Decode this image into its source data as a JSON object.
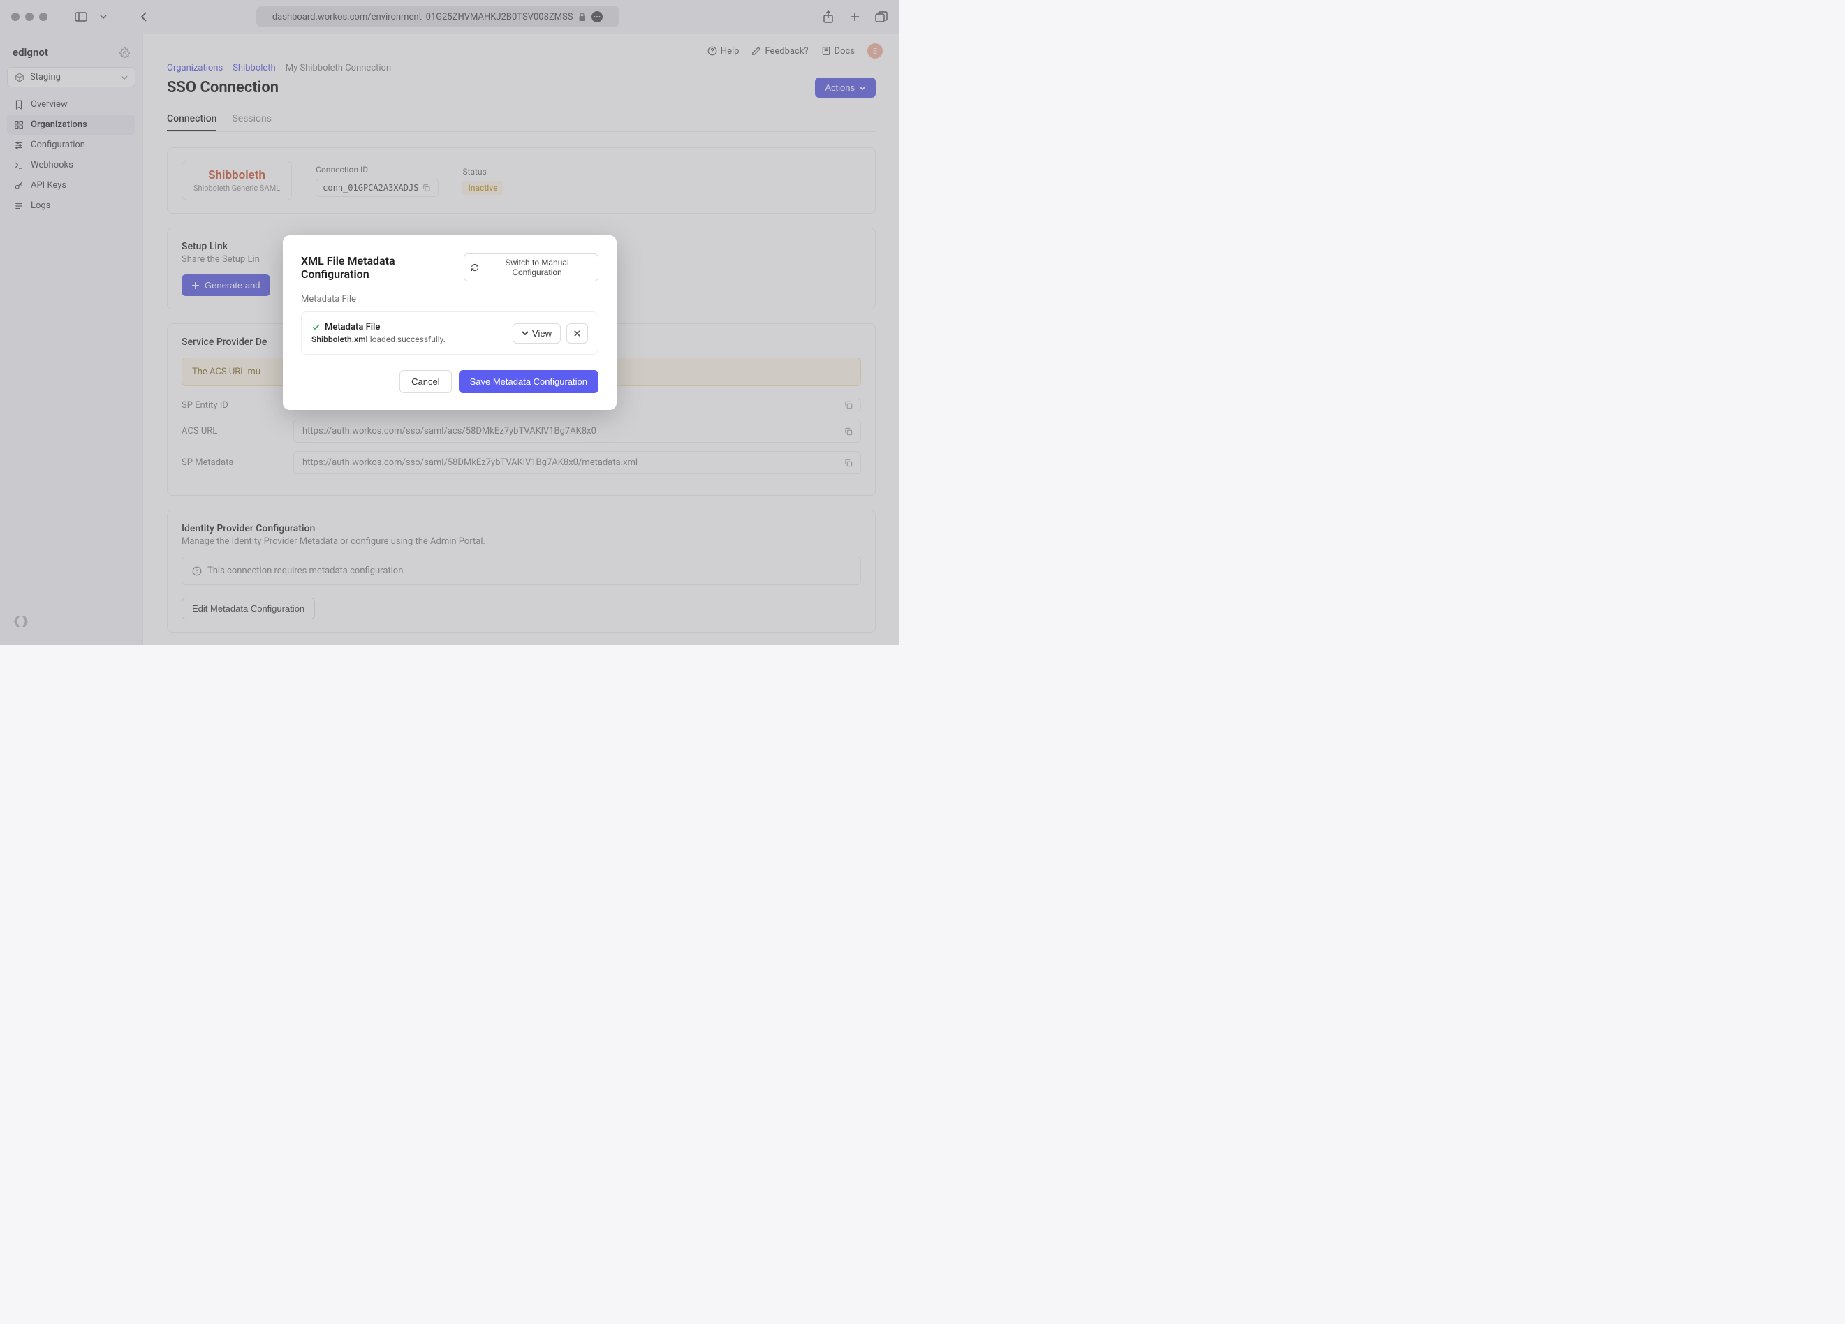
{
  "browser": {
    "url": "dashboard.workos.com/environment_01G25ZHVMAHKJ2B0TSV008ZMSS"
  },
  "org": {
    "name": "edignot",
    "env": "Staging"
  },
  "nav": {
    "overview": "Overview",
    "organizations": "Organizations",
    "configuration": "Configuration",
    "webhooks": "Webhooks",
    "apikeys": "API Keys",
    "logs": "Logs"
  },
  "topbar": {
    "help": "Help",
    "feedback": "Feedback?",
    "docs": "Docs",
    "avatar_initial": "E"
  },
  "breadcrumbs": {
    "a": "Organizations",
    "b": "Shibboleth",
    "c": "My Shibboleth Connection"
  },
  "page": {
    "title": "SSO Connection",
    "actions": "Actions"
  },
  "tabs": {
    "connection": "Connection",
    "sessions": "Sessions"
  },
  "conn": {
    "idp_name": "Shibboleth",
    "idp_sub": "Shibboleth Generic SAML",
    "id_label": "Connection ID",
    "id_value": "conn_01GPCA2A3XADJS",
    "status_label": "Status",
    "status_value": "Inactive"
  },
  "setup": {
    "title": "Setup Link",
    "sub": "Share the Setup Lin",
    "btn": "Generate and"
  },
  "sp": {
    "title": "Service Provider De",
    "warn": "The ACS URL mu",
    "entity_label": "SP Entity ID",
    "entity_value": "",
    "acs_label": "ACS URL",
    "acs_value": "https://auth.workos.com/sso/saml/acs/58DMkEz7ybTVAKlV1Bg7AK8x0",
    "meta_label": "SP Metadata",
    "meta_value": "https://auth.workos.com/sso/saml/58DMkEz7ybTVAKlV1Bg7AK8x0/metadata.xml"
  },
  "idp": {
    "title": "Identity Provider Configuration",
    "sub": "Manage the Identity Provider Metadata or configure using the Admin Portal.",
    "banner": "This connection requires metadata configuration.",
    "edit_btn": "Edit Metadata Configuration"
  },
  "modal": {
    "title": "XML File Metadata Configuration",
    "switch": "Switch to Manual Configuration",
    "section_label": "Metadata File",
    "file_title": "Metadata File",
    "file_name": "Shibboleth.xml",
    "file_suffix": " loaded successfully.",
    "view": "View",
    "cancel": "Cancel",
    "save": "Save Metadata Configuration"
  }
}
